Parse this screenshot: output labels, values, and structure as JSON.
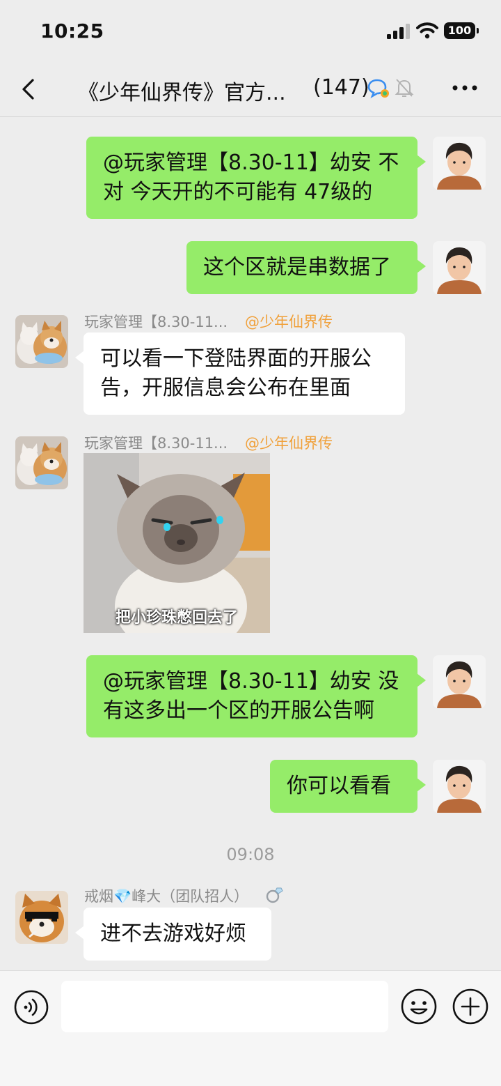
{
  "status_bar": {
    "time": "10:25",
    "battery": "100"
  },
  "header": {
    "back_icon": "chevron-left-icon",
    "title": "《少年仙界传》官方...",
    "member_count": "(147)"
  },
  "colors": {
    "my_bubble": "#95ec69",
    "their_bubble": "#ffffff",
    "background": "#ededed",
    "tag_orange": "#f0a039"
  },
  "messages": [
    {
      "sender": "me",
      "lines": [
        "@玩家管理【8.30-11】幼安 不",
        "对  今天开的不可能有 47级的"
      ]
    },
    {
      "sender": "me",
      "lines": [
        "这个区就是串数据了"
      ]
    },
    {
      "sender": "玩家管理【8.30-11...",
      "tag": "@少年仙界传",
      "lines": [
        "可以看一下登陆界面的开服公",
        "告，开服信息会公布在里面"
      ]
    },
    {
      "sender": "玩家管理【8.30-11...",
      "tag": "@少年仙界传",
      "sticker_caption": "把小珍珠憋回去了"
    },
    {
      "sender": "me",
      "lines": [
        "@玩家管理【8.30-11】幼安 没",
        "有这多出一个区的开服公告啊"
      ]
    },
    {
      "sender": "me",
      "lines": [
        "你可以看看"
      ]
    },
    {
      "divider": "09:08"
    },
    {
      "sender": "戒烟💎峰大（团队招人）",
      "lines": [
        "进不去游戏好烦"
      ]
    }
  ],
  "input_bar": {
    "value": "",
    "icons": [
      "voice-icon",
      "emoji-icon",
      "plus-icon"
    ]
  }
}
